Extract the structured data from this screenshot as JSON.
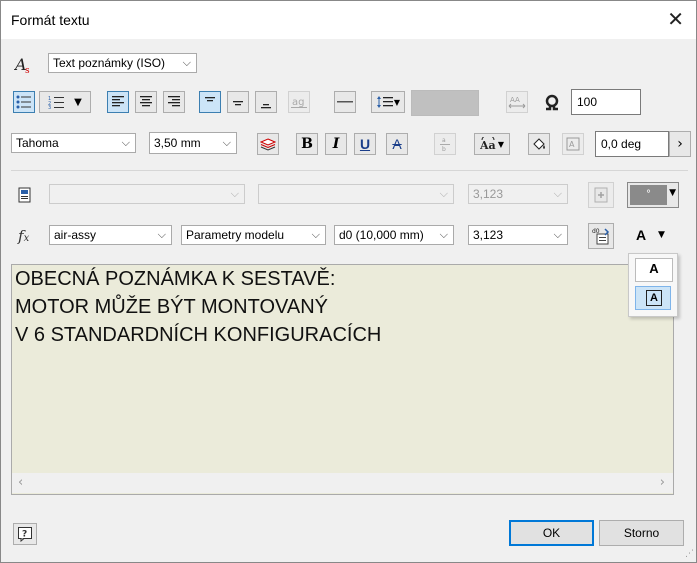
{
  "window": {
    "title": "Formát textu"
  },
  "style_combo": {
    "value": "Text poznámky (ISO)"
  },
  "font_combo": {
    "value": "Tahoma"
  },
  "size_combo": {
    "value": "3,50 mm"
  },
  "width_field": {
    "value": "100"
  },
  "rotation_field": {
    "value": "0,0 deg"
  },
  "buttons": {
    "bold": "B",
    "italic": "I",
    "underline": "U",
    "strike": "A",
    "text_a": "A",
    "popup_a1": "A",
    "popup_a2": "A"
  },
  "row3": {
    "combo1": "",
    "combo2": "",
    "value": "3,123"
  },
  "row4": {
    "component": "air-assy",
    "source": "Parametry modelu",
    "parameter": "d0 (10,000 mm)",
    "precision": "3,123"
  },
  "editor": {
    "lines": [
      "OBECNÁ POZNÁMKA K SESTAVĚ:",
      "",
      "MOTOR MŮŽE BÝT MONTOVANÝ",
      "V 6 STANDARDNÍCH KONFIGURACÍCH"
    ]
  },
  "footer": {
    "ok": "OK",
    "cancel": "Storno"
  },
  "colors": {
    "editor_bg": "#ebebda",
    "accent": "#0078d7",
    "color_swatch": "#c0c0c0"
  }
}
